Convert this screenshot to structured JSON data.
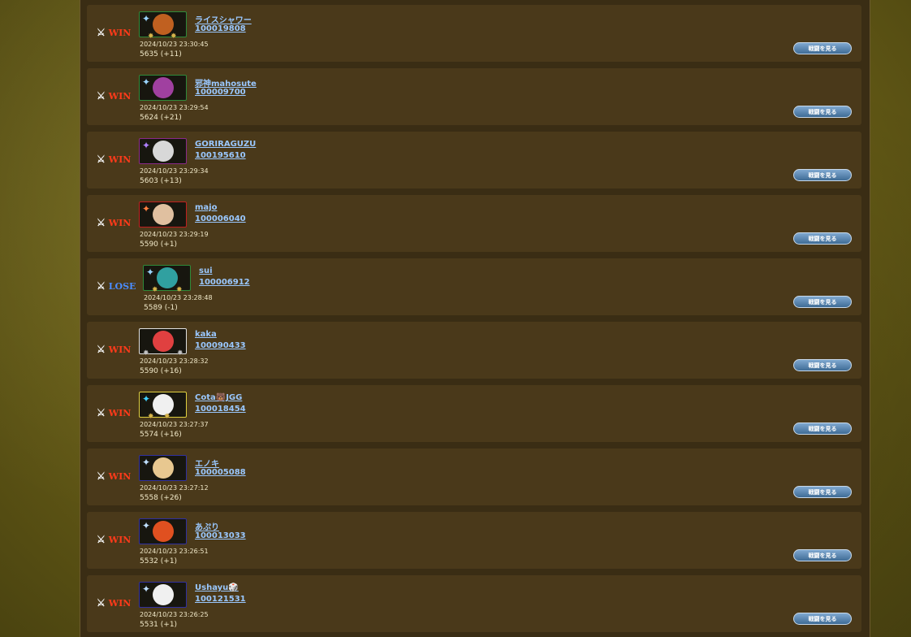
{
  "colors": {
    "win": "#ff3a1a",
    "lose": "#4a8cff",
    "link": "#9ac8ff",
    "row_bg": "#4a391a",
    "panel_bg": "#3a2d14",
    "button": "#4f7aa6"
  },
  "icons": {
    "result": "crossed-swords-icon"
  },
  "matches": [
    {
      "result": "WIN",
      "name": "ライスシャワー",
      "id": "100019808",
      "time": "2024/10/23 23:30:45",
      "score": "5635 (+11)",
      "button": "戦闘を見る",
      "frame": "#2f8a3a",
      "face": "#c06020"
    },
    {
      "result": "WIN",
      "name": "邪神mahosute",
      "id": "100009700",
      "time": "2024/10/23 23:29:54",
      "score": "5624 (+21)",
      "button": "戦闘を見る",
      "frame": "#2f8a3a",
      "face": "#a040a0"
    },
    {
      "result": "WIN",
      "name": "GORIRAGUZU",
      "id": "100195610",
      "time": "2024/10/23 23:29:34",
      "score": "5603 (+13)",
      "button": "戦闘を見る",
      "frame": "#8a2a8a",
      "face": "#d8d8d8"
    },
    {
      "result": "WIN",
      "name": "majo",
      "id": "100006040",
      "time": "2024/10/23 23:29:19",
      "score": "5590 (+1)",
      "button": "戦闘を見る",
      "frame": "#c02020",
      "face": "#e0c0a0"
    },
    {
      "result": "LOSE",
      "name": "sui",
      "id": "100006912",
      "time": "2024/10/23 23:28:48",
      "score": "5589 (-1)",
      "button": "戦闘を見る",
      "frame": "#2f8a3a",
      "face": "#30a0a0"
    },
    {
      "result": "WIN",
      "name": "kaka",
      "id": "100090433",
      "time": "2024/10/23 23:28:32",
      "score": "5590 (+16)",
      "button": "戦闘を見る",
      "frame": "#e0e0e0",
      "face": "#e04040"
    },
    {
      "result": "WIN",
      "name": "Cota🐻JGG",
      "id": "100018454",
      "time": "2024/10/23 23:27:37",
      "score": "5574 (+16)",
      "button": "戦闘を見る",
      "frame": "#e0d040",
      "face": "#f0f0f0"
    },
    {
      "result": "WIN",
      "name": "エノキ",
      "id": "100005088",
      "time": "2024/10/23 23:27:12",
      "score": "5558 (+26)",
      "button": "戦闘を見る",
      "frame": "#3030a0",
      "face": "#e8c890"
    },
    {
      "result": "WIN",
      "name": "あぷり",
      "id": "100013033",
      "time": "2024/10/23 23:26:51",
      "score": "5532 (+1)",
      "button": "戦闘を見る",
      "frame": "#3030a0",
      "face": "#e05020"
    },
    {
      "result": "WIN",
      "name": "Ushayu🎲",
      "id": "100121531",
      "time": "2024/10/23 23:26:25",
      "score": "5531 (+1)",
      "button": "戦闘を見る",
      "frame": "#3030a0",
      "face": "#f0f0f0"
    }
  ]
}
